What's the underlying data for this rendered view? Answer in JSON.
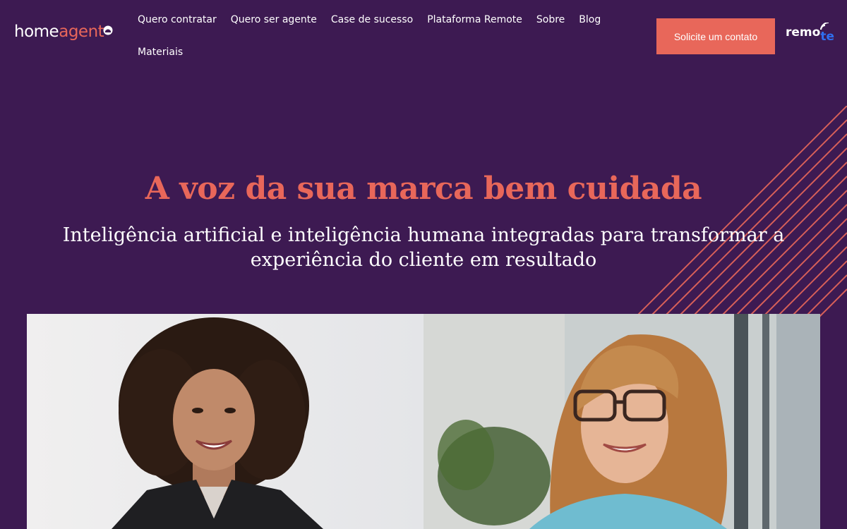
{
  "brand": {
    "logo_home": "home",
    "logo_agent": "agent",
    "logo_icon": "headset-hat-icon"
  },
  "nav": {
    "items": [
      {
        "label": "Quero contratar"
      },
      {
        "label": "Quero ser agente"
      },
      {
        "label": "Case de sucesso"
      },
      {
        "label": "Plataforma Remote"
      },
      {
        "label": "Sobre"
      },
      {
        "label": "Blog"
      },
      {
        "label": "Materiais"
      }
    ]
  },
  "cta": {
    "label": "Solicite um contato"
  },
  "partner": {
    "remo": "remo",
    "te": "te",
    "icon": "signal-waves-icon"
  },
  "hero": {
    "title": "A voz da sua marca bem cuidada",
    "subtitle": "Inteligência artificial e inteligência humana integradas para transformar a experiência do cliente em resultado"
  },
  "photos": [
    {
      "subject": "woman-curly-hair-smiling"
    },
    {
      "subject": "woman-glasses-smiling"
    }
  ],
  "colors": {
    "background": "#3d1a52",
    "accent": "#e8675a",
    "text": "#ffffff",
    "remote_blue": "#2f6ff0"
  }
}
